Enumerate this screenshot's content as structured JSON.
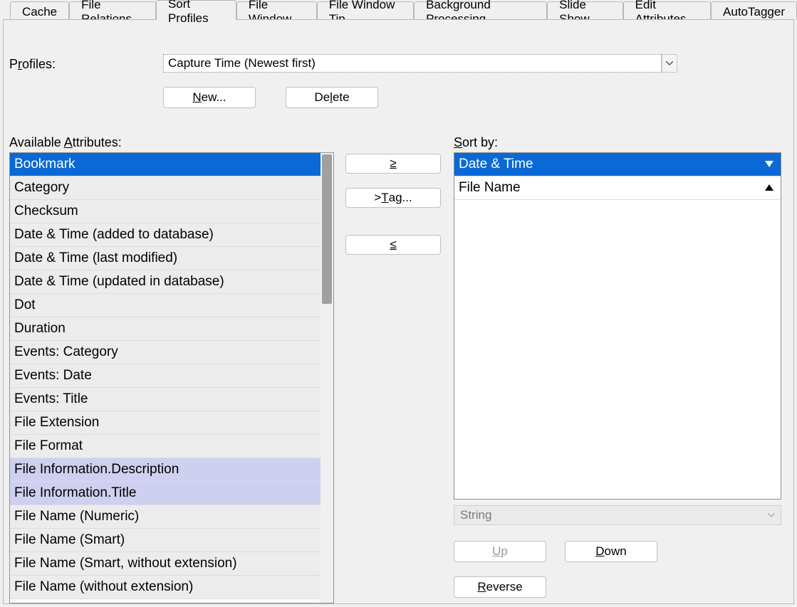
{
  "tabs": [
    "Cache",
    "File Relations",
    "Sort Profiles",
    "File Window",
    "File Window Tip",
    "Background Processing",
    "Slide Show",
    "Edit Attributes",
    "AutoTagger"
  ],
  "active_tab": 2,
  "profiles_label_pre": "P",
  "profiles_label_und": "r",
  "profiles_label_post": "ofiles:",
  "selected_profile": "Capture Time (Newest first)",
  "btn_new_pre": "",
  "btn_new_und": "N",
  "btn_new_post": "ew...",
  "btn_del_pre": "De",
  "btn_del_und": "l",
  "btn_del_post": "ete",
  "avail_label_pre": "Available ",
  "avail_label_und": "A",
  "avail_label_post": "ttributes:",
  "sort_label_pre": "",
  "sort_label_und": "S",
  "sort_label_post": "ort by:",
  "available": [
    {
      "label": "Bookmark",
      "sel": true
    },
    {
      "label": "Category"
    },
    {
      "label": "Checksum"
    },
    {
      "label": "Date & Time (added to database)"
    },
    {
      "label": "Date & Time (last modified)"
    },
    {
      "label": "Date & Time (updated in database)"
    },
    {
      "label": "Dot"
    },
    {
      "label": "Duration"
    },
    {
      "label": "Events: Category"
    },
    {
      "label": "Events: Date"
    },
    {
      "label": "Events: Title"
    },
    {
      "label": "File Extension"
    },
    {
      "label": "File Format"
    },
    {
      "label": "File Information.Description",
      "hl": true
    },
    {
      "label": "File Information.Title",
      "hl": true
    },
    {
      "label": "File Name (Numeric)"
    },
    {
      "label": "File Name (Smart)"
    },
    {
      "label": "File Name (Smart, without extension)"
    },
    {
      "label": "File Name (without extension)"
    }
  ],
  "sort_by": [
    {
      "label": "Date & Time",
      "sel": true,
      "dir": "desc"
    },
    {
      "label": "File Name",
      "dir": "asc"
    }
  ],
  "btn_move_right_und": ">",
  "btn_move_right_post": "",
  "btn_tag_pre": "> ",
  "btn_tag_und": "T",
  "btn_tag_post": "ag...",
  "btn_move_left_und": "<",
  "btn_move_left_post": "",
  "type_value": "String",
  "btn_up_und": "U",
  "btn_up_post": "p",
  "btn_down_und": "D",
  "btn_down_post": "own",
  "btn_rev_und": "R",
  "btn_rev_post": "everse",
  "glyph_ge": "≥",
  "glyph_le": "≤"
}
